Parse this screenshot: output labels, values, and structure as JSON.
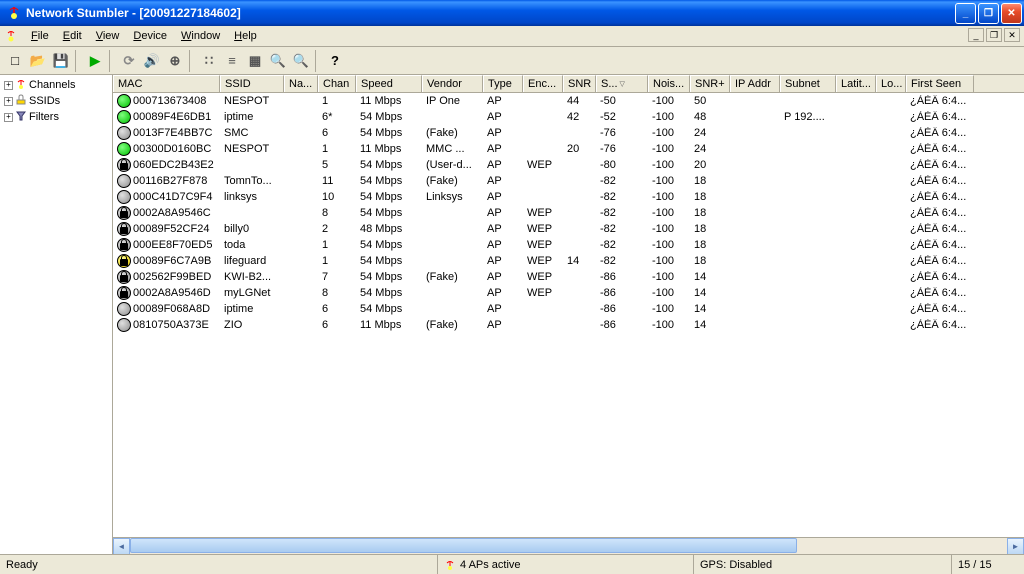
{
  "window": {
    "title": "Network Stumbler - [20091227184602]"
  },
  "menus": [
    "File",
    "Edit",
    "View",
    "Device",
    "Window",
    "Help"
  ],
  "tree": [
    {
      "label": "Channels",
      "icon": "antenna"
    },
    {
      "label": "SSIDs",
      "icon": "ssid"
    },
    {
      "label": "Filters",
      "icon": "filter"
    }
  ],
  "columns": [
    {
      "label": "MAC",
      "cls": "c-mac"
    },
    {
      "label": "SSID",
      "cls": "c-ssid"
    },
    {
      "label": "Na...",
      "cls": "c-na"
    },
    {
      "label": "Chan",
      "cls": "c-chan"
    },
    {
      "label": "Speed",
      "cls": "c-speed"
    },
    {
      "label": "Vendor",
      "cls": "c-vendor"
    },
    {
      "label": "Type",
      "cls": "c-type"
    },
    {
      "label": "Enc...",
      "cls": "c-enc"
    },
    {
      "label": "SNR",
      "cls": "c-snr"
    },
    {
      "label": "S...",
      "cls": "c-sig",
      "sort": "desc"
    },
    {
      "label": "Nois...",
      "cls": "c-noise"
    },
    {
      "label": "SNR+",
      "cls": "c-snrp"
    },
    {
      "label": "IP Addr",
      "cls": "c-ip"
    },
    {
      "label": "Subnet",
      "cls": "c-sub"
    },
    {
      "label": "Latit...",
      "cls": "c-lat"
    },
    {
      "label": "Lo...",
      "cls": "c-lon"
    },
    {
      "label": "First Seen",
      "cls": "c-first"
    }
  ],
  "rows": [
    {
      "sig": "green",
      "lock": false,
      "mac": "000713673408",
      "ssid": "NESPOT",
      "na": "",
      "chan": "1",
      "speed": "11 Mbps",
      "vendor": "IP One",
      "type": "AP",
      "enc": "",
      "snr": "44",
      "s": "-50",
      "noise": "-100",
      "snrp": "50",
      "ip": "",
      "sub": "",
      "lat": "",
      "lon": "",
      "first": "¿ÀÈÄ 6:4..."
    },
    {
      "sig": "green",
      "lock": false,
      "mac": "00089F4E6DB1",
      "ssid": "iptime",
      "na": "",
      "chan": "6*",
      "speed": "54 Mbps",
      "vendor": "",
      "type": "AP",
      "enc": "",
      "snr": "42",
      "s": "-52",
      "noise": "-100",
      "snrp": "48",
      "ip": "",
      "sub": "P 192....",
      "lat": "",
      "lon": "",
      "first": "¿ÀÈÄ 6:4..."
    },
    {
      "sig": "grey",
      "lock": false,
      "mac": "0013F7E4BB7C",
      "ssid": "SMC",
      "na": "",
      "chan": "6",
      "speed": "54 Mbps",
      "vendor": "(Fake)",
      "type": "AP",
      "enc": "",
      "snr": "",
      "s": "-76",
      "noise": "-100",
      "snrp": "24",
      "ip": "",
      "sub": "",
      "lat": "",
      "lon": "",
      "first": "¿ÀÈÄ 6:4..."
    },
    {
      "sig": "green",
      "lock": false,
      "mac": "00300D0160BC",
      "ssid": "NESPOT",
      "na": "",
      "chan": "1",
      "speed": "11 Mbps",
      "vendor": "MMC ...",
      "type": "AP",
      "enc": "",
      "snr": "20",
      "s": "-76",
      "noise": "-100",
      "snrp": "24",
      "ip": "",
      "sub": "",
      "lat": "",
      "lon": "",
      "first": "¿ÀÈÄ 6:4..."
    },
    {
      "sig": "grey",
      "lock": true,
      "mac": "060EDC2B43E2",
      "ssid": "",
      "na": "",
      "chan": "5",
      "speed": "54 Mbps",
      "vendor": "(User-d...",
      "type": "AP",
      "enc": "WEP",
      "snr": "",
      "s": "-80",
      "noise": "-100",
      "snrp": "20",
      "ip": "",
      "sub": "",
      "lat": "",
      "lon": "",
      "first": "¿ÀÈÄ 6:4..."
    },
    {
      "sig": "grey",
      "lock": false,
      "mac": "00116B27F878",
      "ssid": "TomnTo...",
      "na": "",
      "chan": "11",
      "speed": "54 Mbps",
      "vendor": "(Fake)",
      "type": "AP",
      "enc": "",
      "snr": "",
      "s": "-82",
      "noise": "-100",
      "snrp": "18",
      "ip": "",
      "sub": "",
      "lat": "",
      "lon": "",
      "first": "¿ÀÈÄ 6:4..."
    },
    {
      "sig": "grey",
      "lock": false,
      "mac": "000C41D7C9F4",
      "ssid": "linksys",
      "na": "",
      "chan": "10",
      "speed": "54 Mbps",
      "vendor": "Linksys",
      "type": "AP",
      "enc": "",
      "snr": "",
      "s": "-82",
      "noise": "-100",
      "snrp": "18",
      "ip": "",
      "sub": "",
      "lat": "",
      "lon": "",
      "first": "¿ÀÈÄ 6:4..."
    },
    {
      "sig": "grey",
      "lock": true,
      "mac": "0002A8A9546C",
      "ssid": "",
      "na": "",
      "chan": "8",
      "speed": "54 Mbps",
      "vendor": "",
      "type": "AP",
      "enc": "WEP",
      "snr": "",
      "s": "-82",
      "noise": "-100",
      "snrp": "18",
      "ip": "",
      "sub": "",
      "lat": "",
      "lon": "",
      "first": "¿ÀÈÄ 6:4..."
    },
    {
      "sig": "grey",
      "lock": true,
      "mac": "00089F52CF24",
      "ssid": "billy0",
      "na": "",
      "chan": "2",
      "speed": "48 Mbps",
      "vendor": "",
      "type": "AP",
      "enc": "WEP",
      "snr": "",
      "s": "-82",
      "noise": "-100",
      "snrp": "18",
      "ip": "",
      "sub": "",
      "lat": "",
      "lon": "",
      "first": "¿ÀÈÄ 6:4..."
    },
    {
      "sig": "grey",
      "lock": true,
      "mac": "000EE8F70ED5",
      "ssid": "toda",
      "na": "",
      "chan": "1",
      "speed": "54 Mbps",
      "vendor": "",
      "type": "AP",
      "enc": "WEP",
      "snr": "",
      "s": "-82",
      "noise": "-100",
      "snrp": "18",
      "ip": "",
      "sub": "",
      "lat": "",
      "lon": "",
      "first": "¿ÀÈÄ 6:4..."
    },
    {
      "sig": "yellow",
      "lock": true,
      "mac": "00089F6C7A9B",
      "ssid": "lifeguard",
      "na": "",
      "chan": "1",
      "speed": "54 Mbps",
      "vendor": "",
      "type": "AP",
      "enc": "WEP",
      "snr": "14",
      "s": "-82",
      "noise": "-100",
      "snrp": "18",
      "ip": "",
      "sub": "",
      "lat": "",
      "lon": "",
      "first": "¿ÀÈÄ 6:4..."
    },
    {
      "sig": "grey",
      "lock": true,
      "mac": "002562F99BED",
      "ssid": "KWI-B2...",
      "na": "",
      "chan": "7",
      "speed": "54 Mbps",
      "vendor": "(Fake)",
      "type": "AP",
      "enc": "WEP",
      "snr": "",
      "s": "-86",
      "noise": "-100",
      "snrp": "14",
      "ip": "",
      "sub": "",
      "lat": "",
      "lon": "",
      "first": "¿ÀÈÄ 6:4..."
    },
    {
      "sig": "grey",
      "lock": true,
      "mac": "0002A8A9546D",
      "ssid": "myLGNet",
      "na": "",
      "chan": "8",
      "speed": "54 Mbps",
      "vendor": "",
      "type": "AP",
      "enc": "WEP",
      "snr": "",
      "s": "-86",
      "noise": "-100",
      "snrp": "14",
      "ip": "",
      "sub": "",
      "lat": "",
      "lon": "",
      "first": "¿ÀÈÄ 6:4..."
    },
    {
      "sig": "grey",
      "lock": false,
      "mac": "00089F068A8D",
      "ssid": "iptime",
      "na": "",
      "chan": "6",
      "speed": "54 Mbps",
      "vendor": "",
      "type": "AP",
      "enc": "",
      "snr": "",
      "s": "-86",
      "noise": "-100",
      "snrp": "14",
      "ip": "",
      "sub": "",
      "lat": "",
      "lon": "",
      "first": "¿ÀÈÄ 6:4..."
    },
    {
      "sig": "grey",
      "lock": false,
      "mac": "0810750A373E",
      "ssid": "ZIO",
      "na": "",
      "chan": "6",
      "speed": "11 Mbps",
      "vendor": "(Fake)",
      "type": "AP",
      "enc": "",
      "snr": "",
      "s": "-86",
      "noise": "-100",
      "snrp": "14",
      "ip": "",
      "sub": "",
      "lat": "",
      "lon": "",
      "first": "¿ÀÈÄ 6:4..."
    }
  ],
  "status": {
    "ready": "Ready",
    "aps": "4 APs active",
    "gps": "GPS: Disabled",
    "count": "15 / 15"
  },
  "toolbar_icons": [
    {
      "name": "new-icon",
      "glyph": "□",
      "color": "#000"
    },
    {
      "name": "open-icon",
      "glyph": "📂",
      "color": "#c90"
    },
    {
      "name": "save-icon",
      "glyph": "💾",
      "color": "#358"
    },
    {
      "name": "sep"
    },
    {
      "name": "play-icon",
      "glyph": "▶",
      "color": "#0a0"
    },
    {
      "name": "sep"
    },
    {
      "name": "refresh-icon",
      "glyph": "⟳",
      "color": "#888"
    },
    {
      "name": "sound-icon",
      "glyph": "🔊",
      "color": "#555"
    },
    {
      "name": "gps-icon",
      "glyph": "⊕",
      "color": "#555"
    },
    {
      "name": "sep"
    },
    {
      "name": "view1-icon",
      "glyph": "∷",
      "color": "#555"
    },
    {
      "name": "view2-icon",
      "glyph": "≡",
      "color": "#555"
    },
    {
      "name": "view3-icon",
      "glyph": "▦",
      "color": "#555"
    },
    {
      "name": "zoomin-icon",
      "glyph": "🔍",
      "color": "#999"
    },
    {
      "name": "zoomout-icon",
      "glyph": "🔍",
      "color": "#999"
    },
    {
      "name": "sep"
    },
    {
      "name": "help-icon",
      "glyph": "?",
      "color": "#000"
    }
  ]
}
